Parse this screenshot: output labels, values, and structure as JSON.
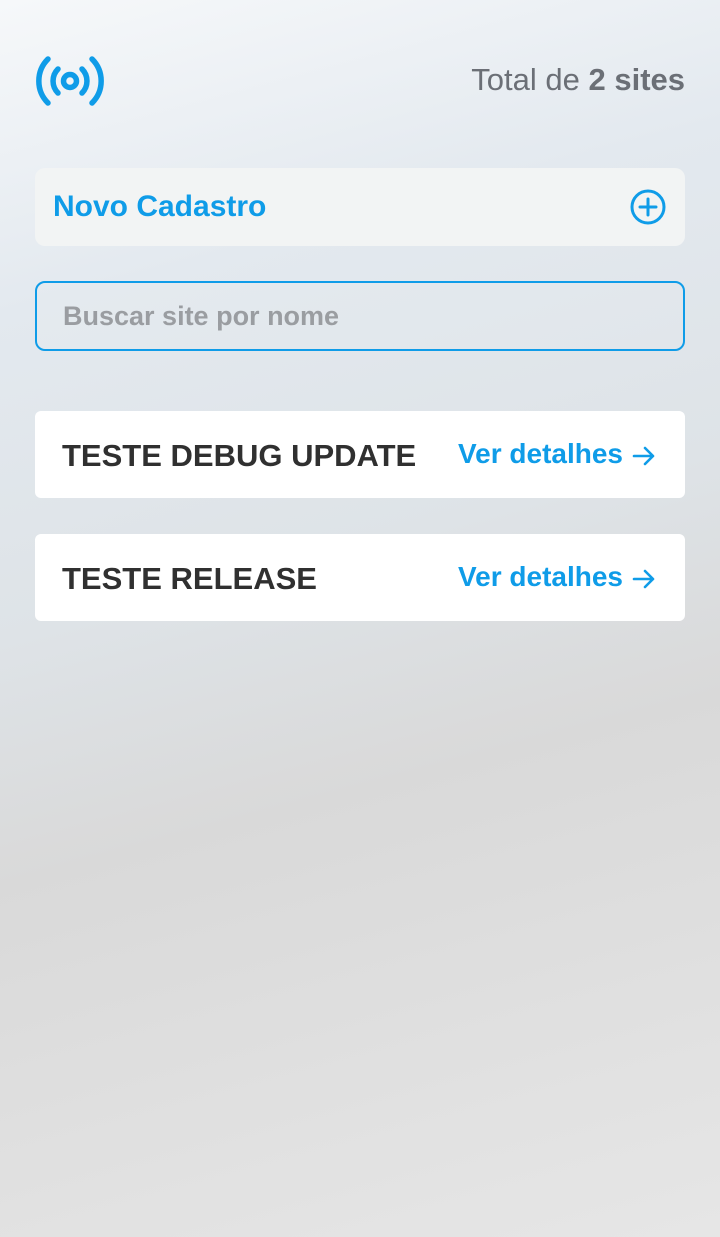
{
  "header": {
    "logo_icon": "broadcast-signal-icon",
    "total_prefix": "Total de",
    "total_value": "2 sites"
  },
  "new_registration": {
    "label": "Novo Cadastro",
    "icon": "plus-circle-icon"
  },
  "search": {
    "placeholder": "Buscar site por nome",
    "value": ""
  },
  "sites": [
    {
      "name": "TESTE DEBUG UPDATE",
      "action_label": "Ver detalhes",
      "action_icon": "arrow-right-icon"
    },
    {
      "name": "TESTE RELEASE",
      "action_label": "Ver detalhes",
      "action_icon": "arrow-right-icon"
    }
  ],
  "colors": {
    "accent": "#0f9ce8",
    "text_dark": "#303030",
    "text_muted": "#6b6f76",
    "card_bg": "#ffffff",
    "new_card_bg": "#f2f4f4"
  }
}
